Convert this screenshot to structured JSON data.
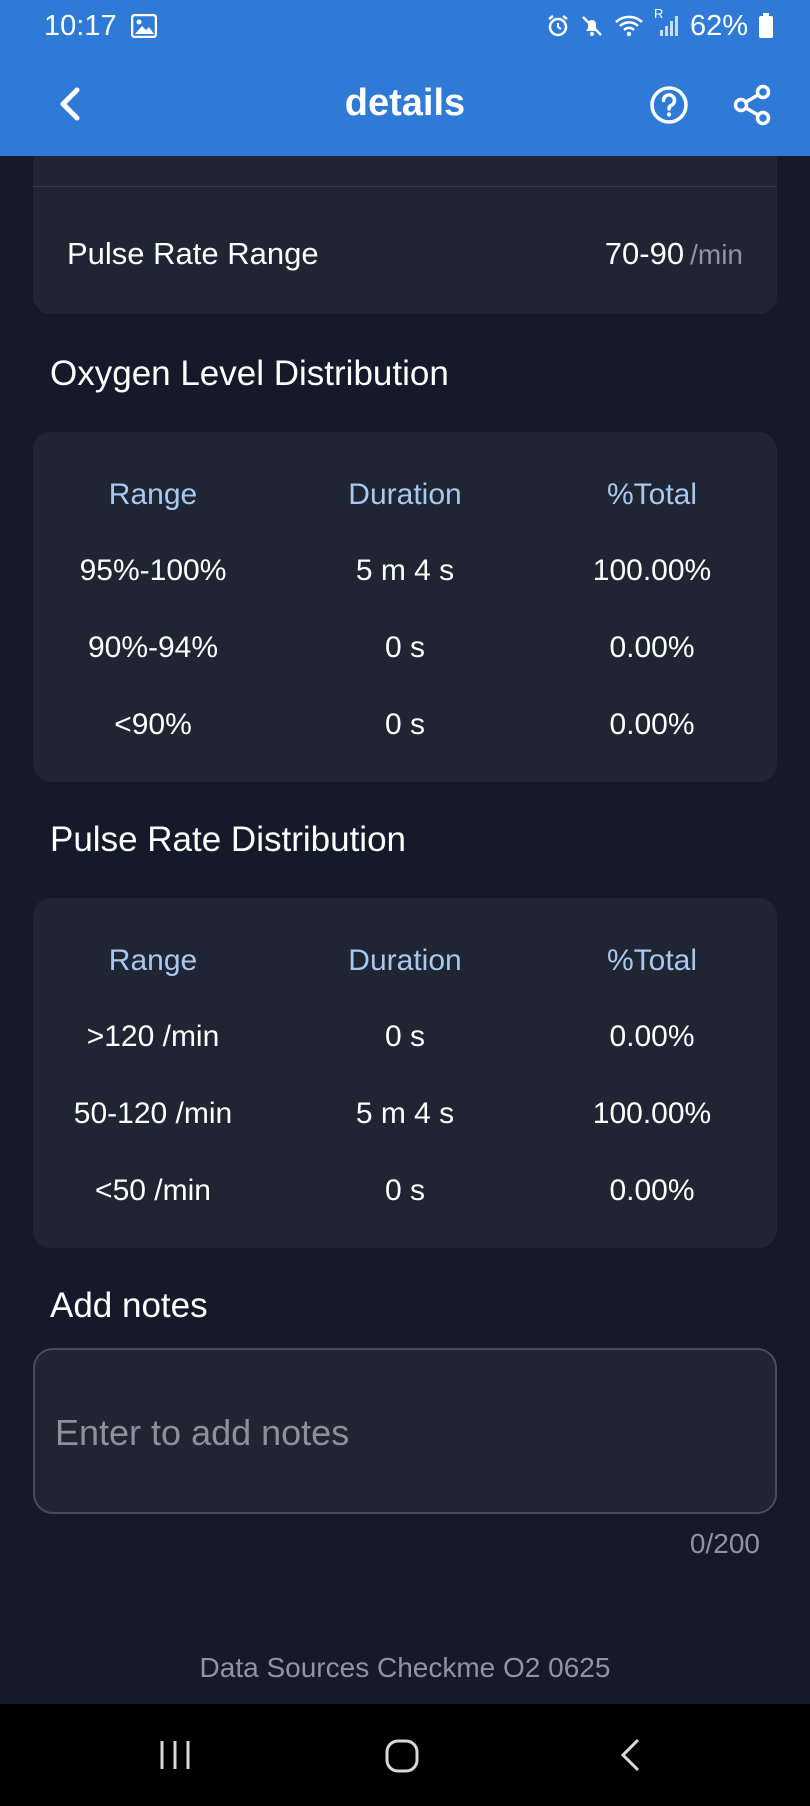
{
  "status_bar": {
    "time": "10:17",
    "battery": "62%",
    "signal_label": "R"
  },
  "app_bar": {
    "title": "details"
  },
  "pulse_rate_range": {
    "label": "Pulse Rate Range",
    "value": "70-90",
    "unit": "/min"
  },
  "oxygen": {
    "title": "Oxygen Level Distribution",
    "headers": [
      "Range",
      "Duration",
      "%Total"
    ],
    "rows": [
      [
        "95%-100%",
        "5 m 4 s",
        "100.00%"
      ],
      [
        "90%-94%",
        "0 s",
        "0.00%"
      ],
      [
        "<90%",
        "0 s",
        "0.00%"
      ]
    ]
  },
  "pulse": {
    "title": "Pulse Rate Distribution",
    "headers": [
      "Range",
      "Duration",
      "%Total"
    ],
    "rows": [
      [
        ">120 /min",
        "0 s",
        "0.00%"
      ],
      [
        "50-120 /min",
        "5 m 4 s",
        "100.00%"
      ],
      [
        "<50 /min",
        "0 s",
        "0.00%"
      ]
    ]
  },
  "notes": {
    "title": "Add notes",
    "placeholder": "Enter to add notes",
    "value": "",
    "counter": "0/200"
  },
  "footer": {
    "data_source": "Data Sources Checkme O2 0625"
  },
  "colors": {
    "app_bar": "#2f7ad6",
    "background": "#141a2a",
    "card": "#1f2533",
    "header_text": "#a8c8f0"
  },
  "icons": [
    "image-icon",
    "alarm-icon",
    "mute-icon",
    "wifi-icon",
    "signal-icon",
    "battery-icon",
    "back-arrow-icon",
    "help-icon",
    "share-icon",
    "recent-apps-icon",
    "home-icon",
    "nav-back-icon"
  ]
}
